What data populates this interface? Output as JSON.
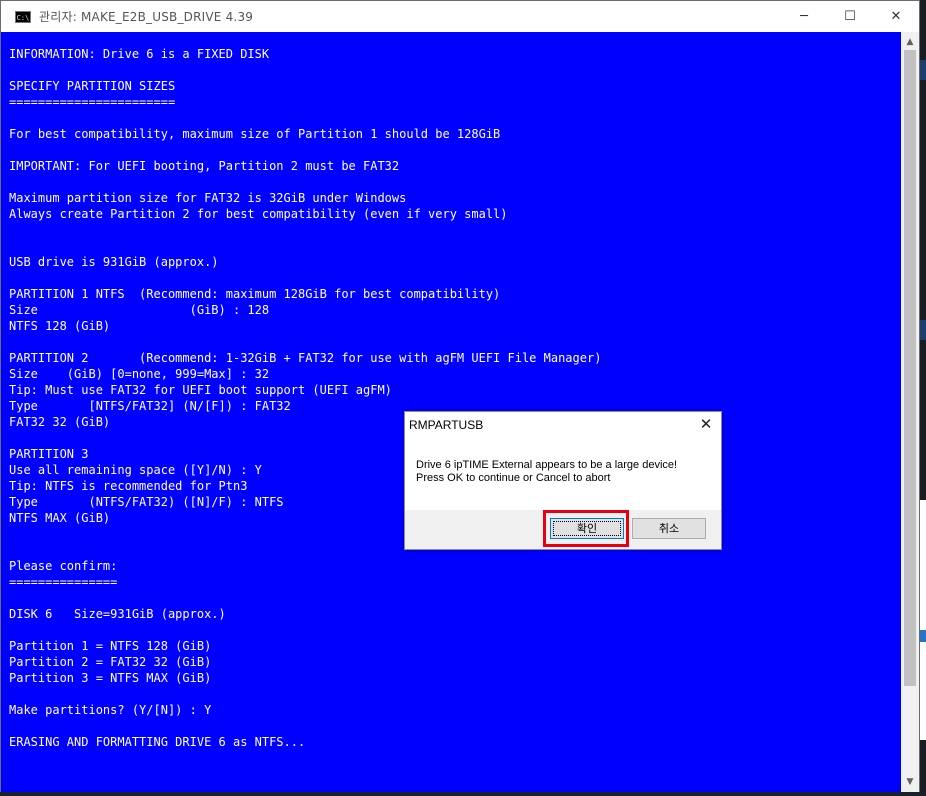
{
  "window": {
    "title": "관리자:  MAKE_E2B_USB_DRIVE 4.39",
    "icon_label": "C:\\",
    "buttons": {
      "minimize": "─",
      "maximize": "☐",
      "close": "✕"
    }
  },
  "console": {
    "lines": [
      "INFORMATION: Drive 6 is a FIXED DISK",
      "",
      "SPECIFY PARTITION SIZES",
      "=======================",
      "",
      "For best compatibility, maximum size of Partition 1 should be 128GiB",
      "",
      "IMPORTANT: For UEFI booting, Partition 2 must be FAT32",
      "",
      "Maximum partition size for FAT32 is 32GiB under Windows",
      "Always create Partition 2 for best compatibility (even if very small)",
      "",
      "",
      "USB drive is 931GiB (approx.)",
      "",
      "PARTITION 1 NTFS  (Recommend: maximum 128GiB for best compatibility)",
      "Size                     (GiB) : 128",
      "NTFS 128 (GiB)",
      "",
      "PARTITION 2       (Recommend: 1-32GiB + FAT32 for use with agFM UEFI File Manager)",
      "Size    (GiB) [0=none, 999=Max] : 32",
      "Tip: Must use FAT32 for UEFI boot support (UEFI agFM)",
      "Type       [NTFS/FAT32] (N/[F]) : FAT32",
      "FAT32 32 (GiB)",
      "",
      "PARTITION 3",
      "Use all remaining space ([Y]/N) : Y",
      "Tip: NTFS is recommended for Ptn3",
      "Type       (NTFS/FAT32) ([N]/F) : NTFS",
      "NTFS MAX (GiB)",
      "",
      "",
      "Please confirm:",
      "===============",
      "",
      "DISK 6   Size=931GiB (approx.)",
      "",
      "Partition 1 = NTFS 128 (GiB)",
      "Partition 2 = FAT32 32 (GiB)",
      "Partition 3 = NTFS MAX (GiB)",
      "",
      "Make partitions? (Y/[N]) : Y",
      "",
      "ERASING AND FORMATTING DRIVE 6 as NTFS..."
    ]
  },
  "scrollbar": {
    "up_arrow": "▲",
    "down_arrow": "▼"
  },
  "dialog": {
    "title": "RMPARTUSB",
    "close": "✕",
    "message_line1": "Drive 6 ipTIME External appears to be a large device!",
    "message_line2": "Press OK to continue or Cancel to abort",
    "ok_label": "확인",
    "cancel_label": "취소"
  },
  "colors": {
    "console_bg": "#0000ff",
    "console_fg": "#ffffff",
    "highlight": "#e60012"
  }
}
